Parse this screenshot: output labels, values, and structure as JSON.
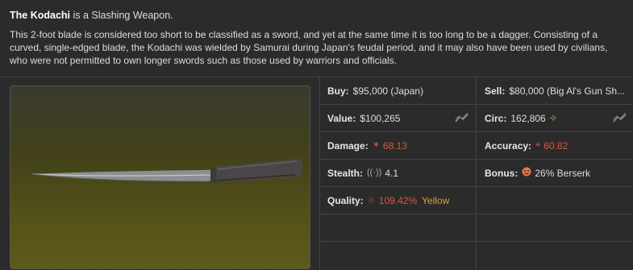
{
  "item": {
    "name": "The Kodachi",
    "type_text": " is a Slashing Weapon.",
    "description": "This 2-foot blade is considered too short to be classified as a sword, and yet at the same time it is too long to be a dagger. Consisting of a curved, single-edged blade, the Kodachi was wielded by Samurai during Japan's feudal period, and it may also have been used by civilians, who were not permitted to own longer swords such as those used by warriors and officials."
  },
  "stats": {
    "buy": {
      "label": "Buy:",
      "value": "$95,000 (Japan)"
    },
    "sell": {
      "label": "Sell:",
      "value": "$80,000 (Big Al's Gun Sh..."
    },
    "value": {
      "label": "Value:",
      "value": "$100,265"
    },
    "circ": {
      "label": "Circ:",
      "value": "162,806"
    },
    "damage": {
      "label": "Damage:",
      "value": "68.13"
    },
    "accuracy": {
      "label": "Accuracy:",
      "value": "60.82"
    },
    "stealth": {
      "label": "Stealth:",
      "value": "4.1"
    },
    "bonus": {
      "label": "Bonus:",
      "value": "26% Berserk"
    },
    "quality": {
      "label": "Quality:",
      "value": "109.42%",
      "grade": "Yellow"
    }
  },
  "icons": {
    "value_trend": "trend-chart-icon",
    "circ_trend": "trend-chart-icon",
    "circ_rarity": "rarity-diamond-icon",
    "damage": "damage-burst-icon",
    "accuracy": "crosshair-icon",
    "stealth": "stealth-sound-icon",
    "bonus": "berserk-icon",
    "quality": "quality-sun-icon"
  },
  "colors": {
    "accent_red": "#e0553f",
    "quality_yellow": "#e0a030",
    "background": "#2b2b2b",
    "border": "#444444"
  }
}
